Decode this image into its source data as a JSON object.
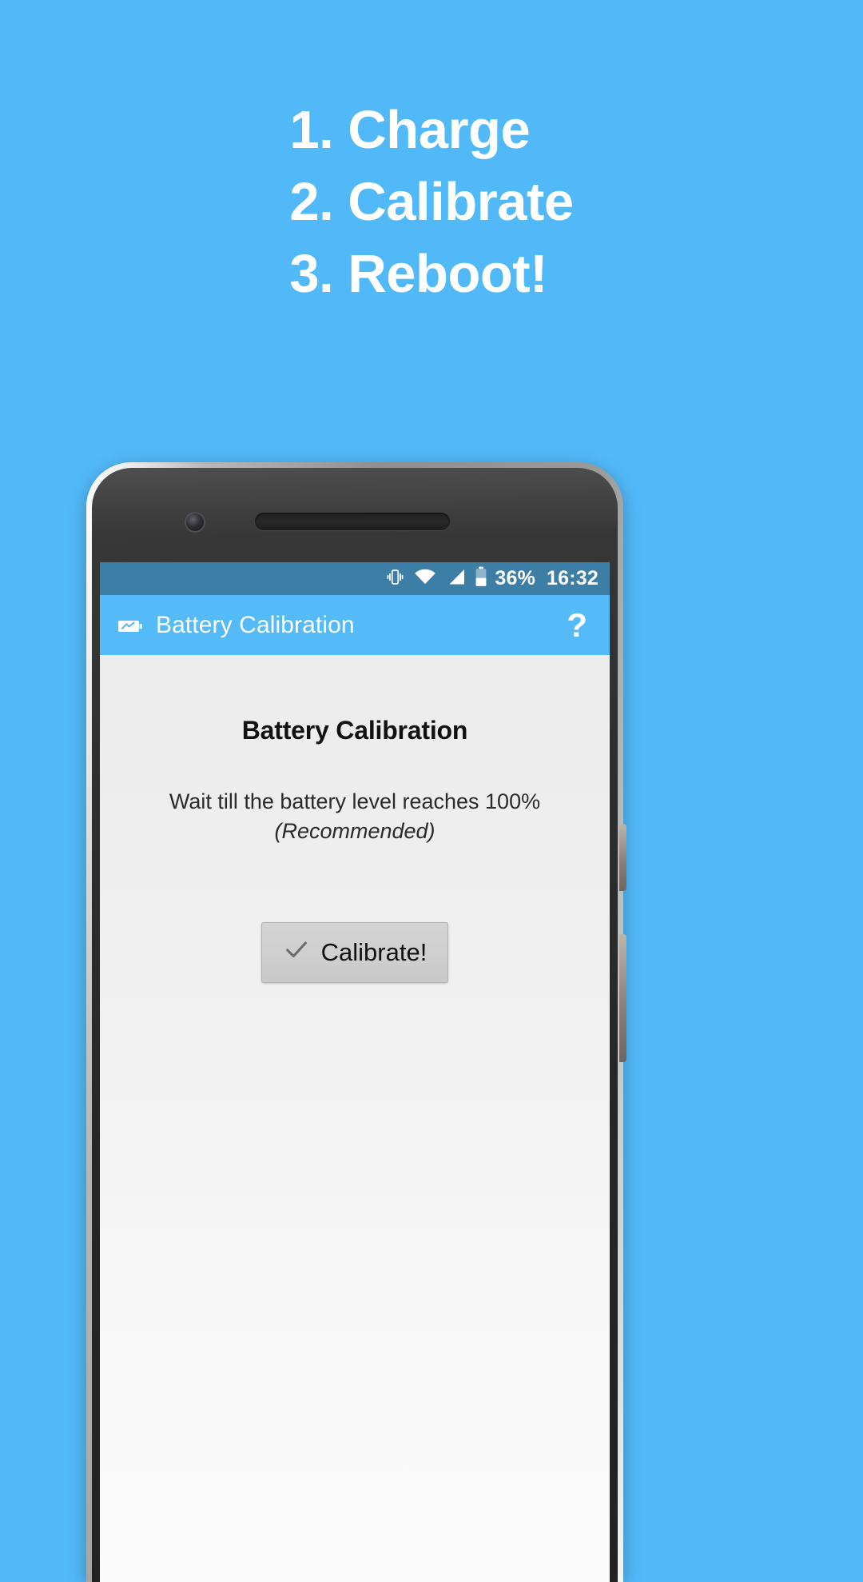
{
  "promo": {
    "background_color": "#52b9f9",
    "text_color": "#ffffff",
    "lines": [
      {
        "text": "1. Charge"
      },
      {
        "text": "2. Calibrate"
      },
      {
        "text": "3. Reboot!"
      }
    ]
  },
  "device": {
    "hardware": {
      "camera_label": "front-camera",
      "earpiece_label": "earpiece-speaker",
      "power_button_label": "power-button",
      "volume_button_label": "volume-button"
    }
  },
  "statusbar": {
    "background_color": "#3c7ea5",
    "icons": [
      "vibrate-icon",
      "wifi-icon",
      "cellular-signal-icon",
      "battery-icon"
    ],
    "battery_percent": "36%",
    "time": "16:32"
  },
  "appbar": {
    "background_color": "#54baf8",
    "icon": "battery-charge-icon",
    "title": "Battery Calibration",
    "help_label": "?"
  },
  "content": {
    "title": "Battery Calibration",
    "body": "Wait till the battery level reaches 100%",
    "note": "(Recommended)",
    "button": {
      "icon": "check-icon",
      "label": "Calibrate!"
    }
  }
}
